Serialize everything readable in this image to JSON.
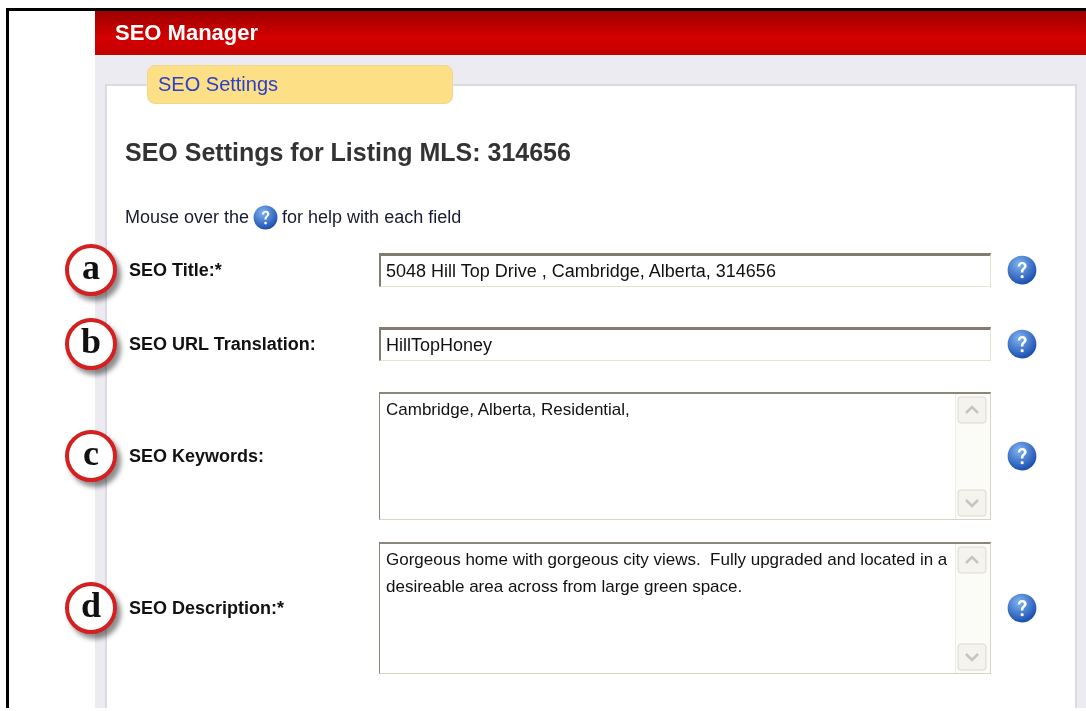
{
  "header": {
    "title": "SEO Manager"
  },
  "tabs": [
    {
      "label": "SEO Settings",
      "selected": true
    }
  ],
  "heading": "SEO Settings for Listing MLS: 314656",
  "help_text": {
    "before": "Mouse over the",
    "after": "for help with each field"
  },
  "fields": [
    {
      "marker": "a",
      "label": "SEO Title:*",
      "kind": "input",
      "value": "5048 Hill Top Drive , Cambridge, Alberta, 314656"
    },
    {
      "marker": "b",
      "label": "SEO URL Translation:",
      "kind": "input",
      "value": "HillTopHoney"
    },
    {
      "marker": "c",
      "label": "SEO Keywords:",
      "kind": "textarea",
      "value": "Cambridge, Alberta, Residential,"
    },
    {
      "marker": "d",
      "label": "SEO Description:*",
      "kind": "textarea",
      "value": "Gorgeous home with gorgeous city views.  Fully upgraded and located in a desireable area across from large green space."
    }
  ]
}
